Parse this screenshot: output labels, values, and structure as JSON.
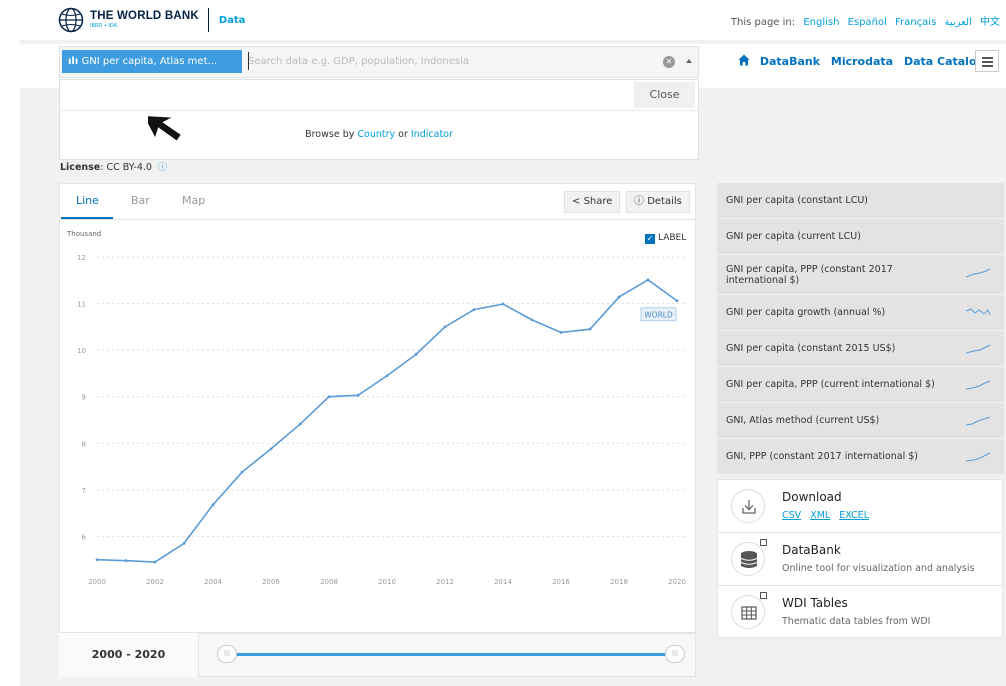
{
  "header": {
    "logo_name": "THE WORLD BANK",
    "logo_sub": "IBRD • IDA",
    "section": "Data",
    "lang_prefix": "This page in:",
    "languages": [
      "English",
      "Español",
      "Français",
      "العربية",
      "中文"
    ]
  },
  "search": {
    "chip_label": "GNI per capita, Atlas met...",
    "placeholder": "Search data e.g. GDP, population, Indonesia",
    "close_label": "Close",
    "browse_prefix": "Browse by",
    "browse_country": "Country",
    "browse_or": "or",
    "browse_indicator": "Indicator"
  },
  "nav": {
    "items": [
      "DataBank",
      "Microdata",
      "Data Catalog"
    ]
  },
  "license": {
    "label": "License",
    "value": ": CC BY-4.0"
  },
  "chart_tabs": [
    "Line",
    "Bar",
    "Map"
  ],
  "chart_buttons": {
    "share": "Share",
    "details": "Details"
  },
  "label_toggle": "LABEL",
  "range_label": "2000 - 2020",
  "chart_data": {
    "type": "line",
    "ylabel": "Thousand",
    "ylim": [
      5,
      12
    ],
    "yticks": [
      6,
      7,
      8,
      9,
      10,
      11,
      12
    ],
    "x": [
      2000,
      2001,
      2002,
      2003,
      2004,
      2005,
      2006,
      2007,
      2008,
      2009,
      2010,
      2011,
      2012,
      2013,
      2014,
      2015,
      2016,
      2017,
      2018,
      2019,
      2020
    ],
    "xticks": [
      2000,
      2002,
      2004,
      2006,
      2008,
      2010,
      2012,
      2014,
      2016,
      2018,
      2020
    ],
    "series": [
      {
        "name": "WORLD",
        "values": [
          5.5,
          5.48,
          5.45,
          5.85,
          6.68,
          7.38,
          7.88,
          8.41,
          9.0,
          9.03,
          9.45,
          9.91,
          10.5,
          10.87,
          10.99,
          10.65,
          10.38,
          10.45,
          11.14,
          11.51,
          11.06
        ]
      }
    ],
    "grid": true,
    "colors": {
      "line": "#5b9bd5"
    }
  },
  "indicators": [
    {
      "label": "GNI per capita (constant LCU)",
      "spark": false
    },
    {
      "label": "GNI per capita (current LCU)",
      "spark": false
    },
    {
      "label": "GNI per capita, PPP (constant 2017 international $)",
      "spark": true
    },
    {
      "label": "GNI per capita growth (annual %)",
      "spark": true
    },
    {
      "label": "GNI per capita (constant 2015 US$)",
      "spark": true
    },
    {
      "label": "GNI per capita, PPP (current international $)",
      "spark": true
    },
    {
      "label": "GNI, Atlas method (current US$)",
      "spark": true
    },
    {
      "label": "GNI, PPP (constant 2017 international $)",
      "spark": true
    }
  ],
  "cards": {
    "download": {
      "title": "Download",
      "links": [
        "CSV",
        "XML",
        "EXCEL"
      ]
    },
    "databank": {
      "title": "DataBank",
      "subtitle": "Online tool for visualization and analysis"
    },
    "wdi": {
      "title": "WDI Tables",
      "subtitle": "Thematic data tables from WDI"
    }
  },
  "colors": {
    "brand_blue": "#0071bc",
    "accent": "#009fda",
    "chip": "#3d9de0",
    "panel_grey": "#f1f1f1"
  }
}
